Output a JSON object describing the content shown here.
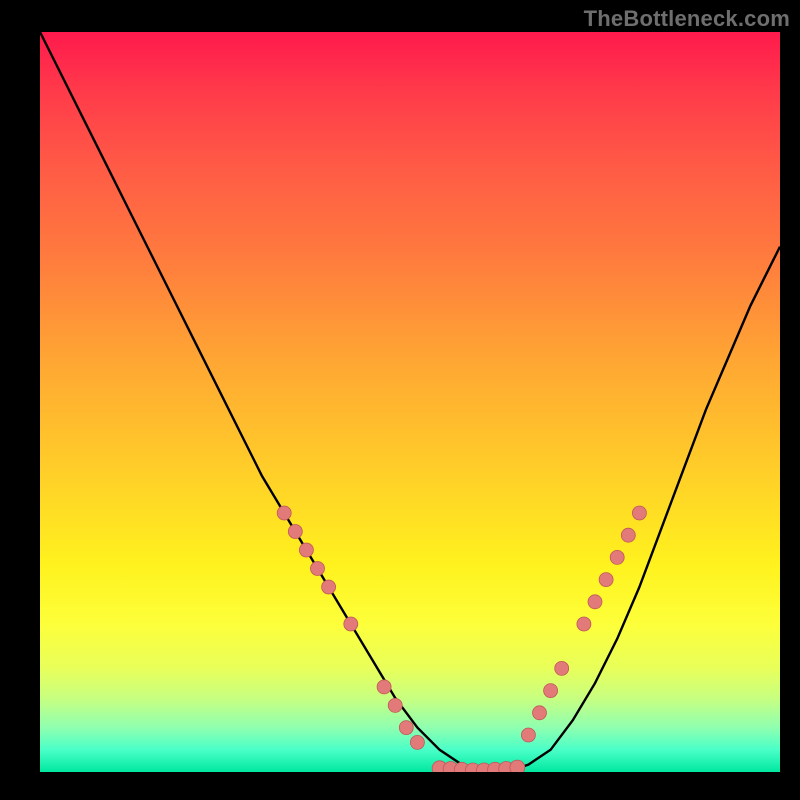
{
  "watermark": "TheBottleneck.com",
  "colors": {
    "background": "#000000",
    "curve": "#000000",
    "marker_fill": "#e37a7a",
    "marker_stroke": "#c05858"
  },
  "chart_data": {
    "type": "line",
    "title": "",
    "xlabel": "",
    "ylabel": "",
    "xlim": [
      0,
      100
    ],
    "ylim": [
      0,
      100
    ],
    "grid": false,
    "legend": false,
    "x": [
      0,
      3,
      6,
      9,
      12,
      15,
      18,
      21,
      24,
      27,
      30,
      33,
      36,
      39,
      42,
      45,
      48,
      51,
      54,
      57,
      60,
      63,
      66,
      69,
      72,
      75,
      78,
      81,
      84,
      87,
      90,
      93,
      96,
      100
    ],
    "y": [
      100,
      94,
      88,
      82,
      76,
      70,
      64,
      58,
      52,
      46,
      40,
      35,
      30,
      25,
      20,
      15,
      10,
      6,
      3,
      1,
      0,
      0,
      1,
      3,
      7,
      12,
      18,
      25,
      33,
      41,
      49,
      56,
      63,
      71
    ],
    "markers": {
      "left_branch_x": [
        33,
        34.5,
        36,
        37.5,
        39,
        42,
        46.5,
        48,
        49.5,
        51
      ],
      "left_branch_y": [
        35,
        32.5,
        30,
        27.5,
        25,
        20,
        11.5,
        9,
        6,
        4
      ],
      "right_branch_x": [
        66,
        67.5,
        69,
        70.5,
        73.5,
        75,
        76.5,
        78,
        79.5,
        81
      ],
      "right_branch_y": [
        5,
        8,
        11,
        14,
        20,
        23,
        26,
        29,
        32,
        35
      ],
      "flat_x": [
        54,
        55.5,
        57,
        58.5,
        60,
        61.5,
        63,
        64.5
      ],
      "flat_y": [
        0.5,
        0.4,
        0.3,
        0.2,
        0.2,
        0.3,
        0.4,
        0.6
      ]
    }
  }
}
